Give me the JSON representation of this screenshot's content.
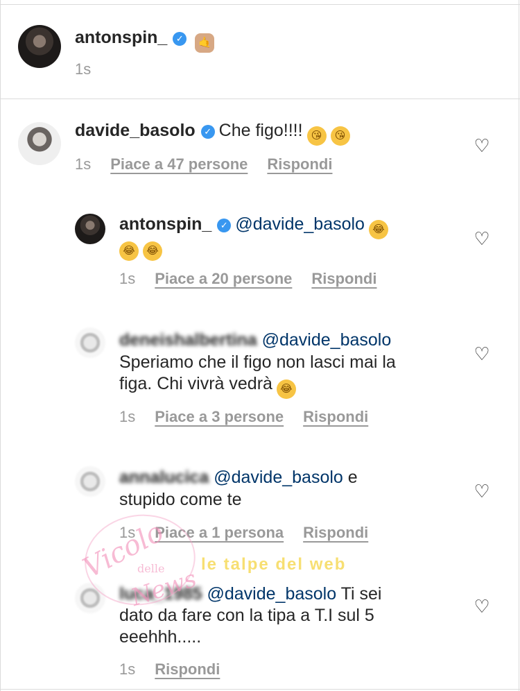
{
  "time_label": "1s",
  "heart_symbol": "♡",
  "verified_mark": "✓",
  "post": {
    "username": "antonspin_",
    "emoji": "🤙",
    "time": "1s"
  },
  "comments": [
    {
      "username": "davide_basolo",
      "verified": true,
      "text": "Che figo!!!!",
      "emojis": [
        "😘",
        "😘"
      ],
      "time": "1s",
      "likes": "Piace a 47 persone",
      "reply": "Rispondi"
    },
    {
      "username": "antonspin_",
      "verified": true,
      "mention": "@davide_basolo",
      "emojis": [
        "😂",
        "😂",
        "😂"
      ],
      "time": "1s",
      "likes": "Piace a 20 persone",
      "reply": "Rispondi"
    },
    {
      "username": "deneishalbertina",
      "mention": "@davide_basolo",
      "line1": "Speriamo che il figo non lasci mai la",
      "line2": "figa. Chi vivrà vedrà",
      "emoji": "😂",
      "time": "1s",
      "likes": "Piace a 3 persone",
      "reply": "Rispondi"
    },
    {
      "username": "annalucica",
      "mention": "@davide_basolo",
      "tail": "e",
      "line2": "stupido come te",
      "time": "1s",
      "likes": "Piace a 1 persona",
      "reply": "Rispondi"
    },
    {
      "username": "luca_1985",
      "mention": "@davide_basolo",
      "tail": "Ti sei",
      "line2": "dato da fare con la tipa a T.I sul 5",
      "line3": "eeehhh.....",
      "time": "1s",
      "reply": "Rispondi"
    }
  ],
  "watermarks": {
    "vicolo": "Vicolo",
    "delle": "delle",
    "news": "News",
    "talpe": "le talpe del web"
  }
}
